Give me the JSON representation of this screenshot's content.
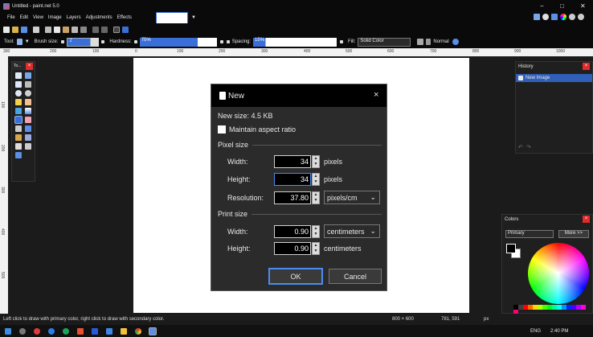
{
  "window": {
    "title": "Untitled - paint.net 5.0",
    "minimize": "−",
    "maximize": "□",
    "close": "✕"
  },
  "menu": {
    "items": [
      "File",
      "Edit",
      "View",
      "Image",
      "Layers",
      "Adjustments",
      "Effects"
    ]
  },
  "toolbar_options": {
    "tool_label": "Tool:",
    "brush_size_label": "Brush size:",
    "brush_size_value": "2",
    "hardness_label": "Hardness:",
    "hardness_value": "75%",
    "spacing_label": "Spacing:",
    "spacing_value": "15%",
    "fill_label": "Fill:",
    "fill_value": "Solid Color",
    "blend_mode": "Normal"
  },
  "ruler": {
    "ticks": [
      "300",
      "200",
      "100",
      "0",
      "100",
      "200",
      "300",
      "400",
      "500",
      "600",
      "700",
      "800",
      "900",
      "1000"
    ]
  },
  "left_ruler": {
    "ticks": [
      "100",
      "200",
      "300",
      "400",
      "500"
    ]
  },
  "tools_panel": {
    "title": "To..."
  },
  "history_panel": {
    "title": "History",
    "items": [
      "New Image"
    ]
  },
  "colors_panel": {
    "title": "Colors",
    "selector": "Primary",
    "more_button": "More >>"
  },
  "dialog": {
    "title": "New",
    "new_size": "New size: 4.5 KB",
    "maintain_aspect": "Maintain aspect ratio",
    "pixel_size_label": "Pixel size",
    "width_label": "Width:",
    "width_value": "34",
    "width_unit": "pixels",
    "height_label": "Height:",
    "height_value": "34",
    "height_unit": "pixels",
    "resolution_label": "Resolution:",
    "resolution_value": "37.80",
    "resolution_unit": "pixels/cm",
    "print_size_label": "Print size",
    "print_width_label": "Width:",
    "print_width_value": "0.90",
    "print_width_unit": "centimeters",
    "print_height_label": "Height:",
    "print_height_value": "0.90",
    "print_height_unit": "centimeters",
    "ok": "OK",
    "cancel": "Cancel"
  },
  "status": {
    "hint": "Left click to draw with primary color, right click to draw with secondary color.",
    "image_size": "800 × 600",
    "cursor_pos": "781, 591",
    "unit": "px"
  },
  "taskbar": {
    "language": "ENG",
    "time": "2:40 PM"
  },
  "colors": {
    "accent": "#3a6fd8",
    "close_red": "#e02b2b",
    "selected_history": "#2f5fb8"
  }
}
